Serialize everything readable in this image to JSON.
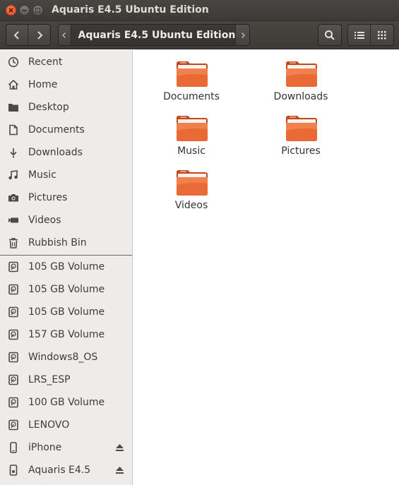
{
  "window": {
    "title": "Aquaris E4.5 Ubuntu Edition"
  },
  "toolbar": {
    "back_icon": "chevron-left-icon",
    "forward_icon": "chevron-right-icon",
    "path_crumb": "Aquaris E4.5 Ubuntu Edition",
    "search_icon": "search-icon",
    "list_view_icon": "list-icon",
    "grid_view_icon": "grid-icon"
  },
  "sidebar": {
    "places": [
      {
        "label": "Recent",
        "icon": "clock-icon"
      },
      {
        "label": "Home",
        "icon": "home-icon"
      },
      {
        "label": "Desktop",
        "icon": "folder-icon"
      },
      {
        "label": "Documents",
        "icon": "document-icon"
      },
      {
        "label": "Downloads",
        "icon": "download-icon"
      },
      {
        "label": "Music",
        "icon": "music-icon"
      },
      {
        "label": "Pictures",
        "icon": "camera-icon"
      },
      {
        "label": "Videos",
        "icon": "video-icon"
      },
      {
        "label": "Rubbish Bin",
        "icon": "trash-icon"
      }
    ],
    "devices": [
      {
        "label": "105 GB Volume",
        "icon": "drive-icon"
      },
      {
        "label": "105 GB Volume",
        "icon": "drive-icon"
      },
      {
        "label": "105 GB Volume",
        "icon": "drive-icon"
      },
      {
        "label": "157 GB Volume",
        "icon": "drive-icon"
      },
      {
        "label": "Windows8_OS",
        "icon": "drive-icon"
      },
      {
        "label": "LRS_ESP",
        "icon": "drive-icon"
      },
      {
        "label": "100 GB Volume",
        "icon": "drive-icon"
      },
      {
        "label": "LENOVO",
        "icon": "drive-icon"
      },
      {
        "label": "iPhone",
        "icon": "phone-icon",
        "eject": true
      },
      {
        "label": "Aquaris E4.5",
        "icon": "media-player-icon",
        "eject": true
      }
    ]
  },
  "content": {
    "folders": [
      {
        "label": "Documents"
      },
      {
        "label": "Downloads"
      },
      {
        "label": "Music"
      },
      {
        "label": "Pictures"
      },
      {
        "label": "Videos"
      }
    ]
  },
  "colors": {
    "folder_orange": "#e9632f",
    "titlebar": "#3c3b37",
    "sidebar_bg": "#edecea",
    "close_button": "#e3541f"
  }
}
